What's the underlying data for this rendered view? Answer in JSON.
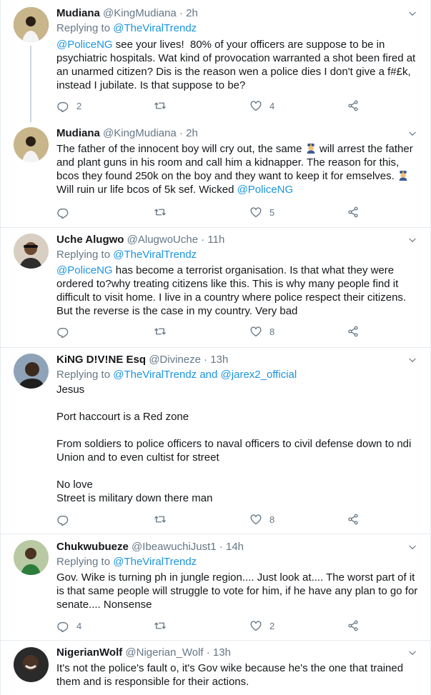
{
  "tweets": [
    {
      "name": "Mudiana",
      "handle": "@KingMudiana",
      "time": "2h",
      "replying_prefix": "Replying to ",
      "replying_to": "@TheViralTrendz",
      "mention": "@PoliceNG",
      "text": " see your lives!  80% of your officers are suppose to be in psychiatric hospitals. Wat kind of provocation warranted a shot been fired at an unarmed citizen? Dis is the reason wen a police dies I don't give a f#£k, instead I jubilate. Is that suppose to be?",
      "replies": "2",
      "retweets": "",
      "likes": "4",
      "avatar_color": "#3a3a2e"
    },
    {
      "name": "Mudiana",
      "handle": "@KingMudiana",
      "time": "2h",
      "text_a": "The father of the innocent boy will cry out, the same ",
      "text_b": " will arrest the father and plant guns in his room and call him a kidnapper. The reason for this, bcos they found 250k on the boy and they want to keep it for emselves. ",
      "text_c": " Will ruin ur life bcos of 5k sef. Wicked ",
      "mention": "@PoliceNG",
      "emoji_name": "police-officer-emoji",
      "replies": "",
      "retweets": "",
      "likes": "5",
      "avatar_color": "#3a3a2e"
    },
    {
      "name": "Uche Alugwo",
      "handle": "@AlugwoUche",
      "time": "11h",
      "replying_prefix": "Replying to ",
      "replying_to": "@TheViralTrendz",
      "mention": "@PoliceNG",
      "text": " has become a terrorist organisation. Is that what they were ordered to?why treating citizens like this. This is why many people find it difficult to visit home. I live in a country where police respect their citizens. But the reverse is the case in my country. Very bad",
      "replies": "",
      "retweets": "",
      "likes": "8",
      "avatar_color": "#6b5a4a"
    },
    {
      "name": "KiNG D!V!NE Esq",
      "handle": "@Divineze",
      "time": "13h",
      "replying_prefix": "Replying to ",
      "replying_to": "@TheViralTrendz",
      "replying_and": " and ",
      "replying_to_2": "@jarex2_official",
      "text": "Jesus\n\nPort haccourt is a Red zone\n\nFrom soldiers to police officers to naval officers to civil defense down to ndi Union and to even cultist for street\n\nNo love\nStreet is military down there man",
      "replies": "",
      "retweets": "",
      "likes": "8",
      "avatar_color": "#2b2b2b"
    },
    {
      "name": "Chukwubueze",
      "handle": "@IbeawuchiJust1",
      "time": "14h",
      "replying_prefix": "Replying to ",
      "replying_to": "@TheViralTrendz",
      "text": "Gov. Wike is turning ph in jungle region.... Just look at.... The worst part of it is that same people will struggle to vote for him, if he have any plan to go for senate.... Nonsense",
      "replies": "4",
      "retweets": "",
      "likes": "2",
      "avatar_color": "#5a7a3a"
    },
    {
      "name": "NigerianWolf",
      "handle": "@Nigerian_Wolf",
      "time": "13h",
      "text": "It's not the police's fault o, it's Gov wike because he's the one that trained them and is responsible for their actions.",
      "avatar_color": "#1e1e1e"
    }
  ],
  "icons": {
    "reply": "reply-icon",
    "retweet": "retweet-icon",
    "like": "heart-icon",
    "share": "share-icon",
    "more": "chevron-down-icon"
  },
  "colors": {
    "link": "#1b95e0",
    "secondary_text": "#657786",
    "border": "#e6ecf0"
  }
}
